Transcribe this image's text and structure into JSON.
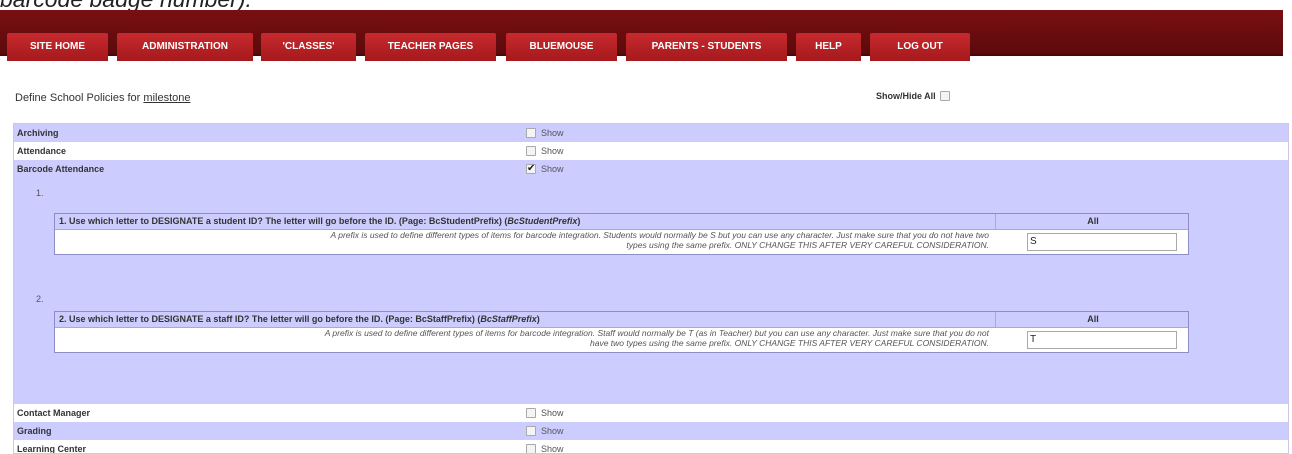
{
  "caption": "barcode badge number).",
  "nav": {
    "tabs": [
      {
        "label": "SITE HOME"
      },
      {
        "label": "ADMINISTRATION"
      },
      {
        "label": "'CLASSES'"
      },
      {
        "label": "TEACHER PAGES"
      },
      {
        "label": "BLUEMOUSE"
      },
      {
        "label": "PARENTS - STUDENTS"
      },
      {
        "label": "HELP"
      },
      {
        "label": "LOG OUT"
      }
    ]
  },
  "policy": {
    "title_prefix": "Define School Policies for",
    "school": "milestone",
    "show_hide_all": "Show/Hide All"
  },
  "categories": [
    {
      "name": "Archiving",
      "show": "Show",
      "checked": false
    },
    {
      "name": "Attendance",
      "show": "Show",
      "checked": false
    },
    {
      "name": "Barcode Attendance",
      "show": "Show",
      "checked": true
    },
    {
      "name": "Contact Manager",
      "show": "Show",
      "checked": false
    },
    {
      "name": "Grading",
      "show": "Show",
      "checked": false
    },
    {
      "name": "Learning Center",
      "show": "Show",
      "checked": false
    }
  ],
  "settings": [
    {
      "number": "1.",
      "question": "1. Use which letter to DESIGNATE a student ID? The letter will go before the ID. (Page: BcStudentPrefix) (",
      "key": "BcStudentPrefix",
      "close": ")",
      "scope": "All",
      "desc_line1": "A prefix is used to define different types of items for barcode integration. Students would normally be S but you can use any character. Just make sure that you do not have two",
      "desc_line2": "types using the same prefix. ONLY CHANGE THIS AFTER VERY CAREFUL CONSIDERATION.",
      "value": "S"
    },
    {
      "number": "2.",
      "question": "2. Use which letter to DESIGNATE a staff ID? The letter will go before the ID. (Page: BcStaffPrefix) (",
      "key": "BcStaffPrefix",
      "close": ")",
      "scope": "All",
      "desc_line1": "A prefix is used to define different types of items for barcode integration. Staff would normally be T (as in Teacher) but you can use any character. Just make sure that you do not",
      "desc_line2": "have two types using the same prefix. ONLY CHANGE THIS AFTER VERY CAREFUL CONSIDERATION.",
      "value": "T"
    }
  ],
  "colors": {
    "nav_bar": "#6b0c0f",
    "tab": "#b82226",
    "row_shade": "#ccccff"
  }
}
